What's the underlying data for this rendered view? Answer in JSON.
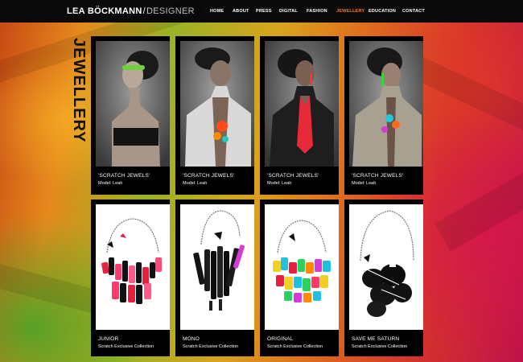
{
  "brand": {
    "name": "LEA BÖCKMANN",
    "separator": "/",
    "role": "DESIGNER"
  },
  "nav": {
    "items": [
      {
        "label": "HOME",
        "active": false
      },
      {
        "label": "ABOUT",
        "active": false
      },
      {
        "label": "PRESS",
        "active": false
      },
      {
        "label": "DIGITAL",
        "active": false
      },
      {
        "label": "FASHION",
        "active": false
      },
      {
        "label": "JEWELLERY",
        "active": true
      },
      {
        "label": "EDUCATION",
        "active": false
      },
      {
        "label": "CONTACT",
        "active": false
      }
    ]
  },
  "section": {
    "title": "JEWELLERY/"
  },
  "colors": {
    "accent": "#ff7a1a",
    "card": "#000000",
    "text": "#ffffff"
  },
  "gallery": {
    "row1": [
      {
        "title": "'SCRATCH JEWELS'",
        "subtitle": "Model: Leah"
      },
      {
        "title": "'SCRATCH JEWELS'",
        "subtitle": "Model: Leah"
      },
      {
        "title": "'SCRATCH JEWELS'",
        "subtitle": "Model: Leah"
      },
      {
        "title": "'SCRATCH JEWELS'",
        "subtitle": "Model: Leah"
      }
    ],
    "row2": [
      {
        "title": "JUNIOR",
        "subtitle": "Scratch Exclusive Collection"
      },
      {
        "title": "MONO",
        "subtitle": "Scratch Exclusive Collection"
      },
      {
        "title": "ORIGINAL",
        "subtitle": "Scratch Exclusive Collection"
      },
      {
        "title": "SAVE ME SATURN",
        "subtitle": "Scratch Exclusive Collection"
      }
    ]
  },
  "icons": [
    "model-photo-icon",
    "necklace-photo-icon"
  ]
}
